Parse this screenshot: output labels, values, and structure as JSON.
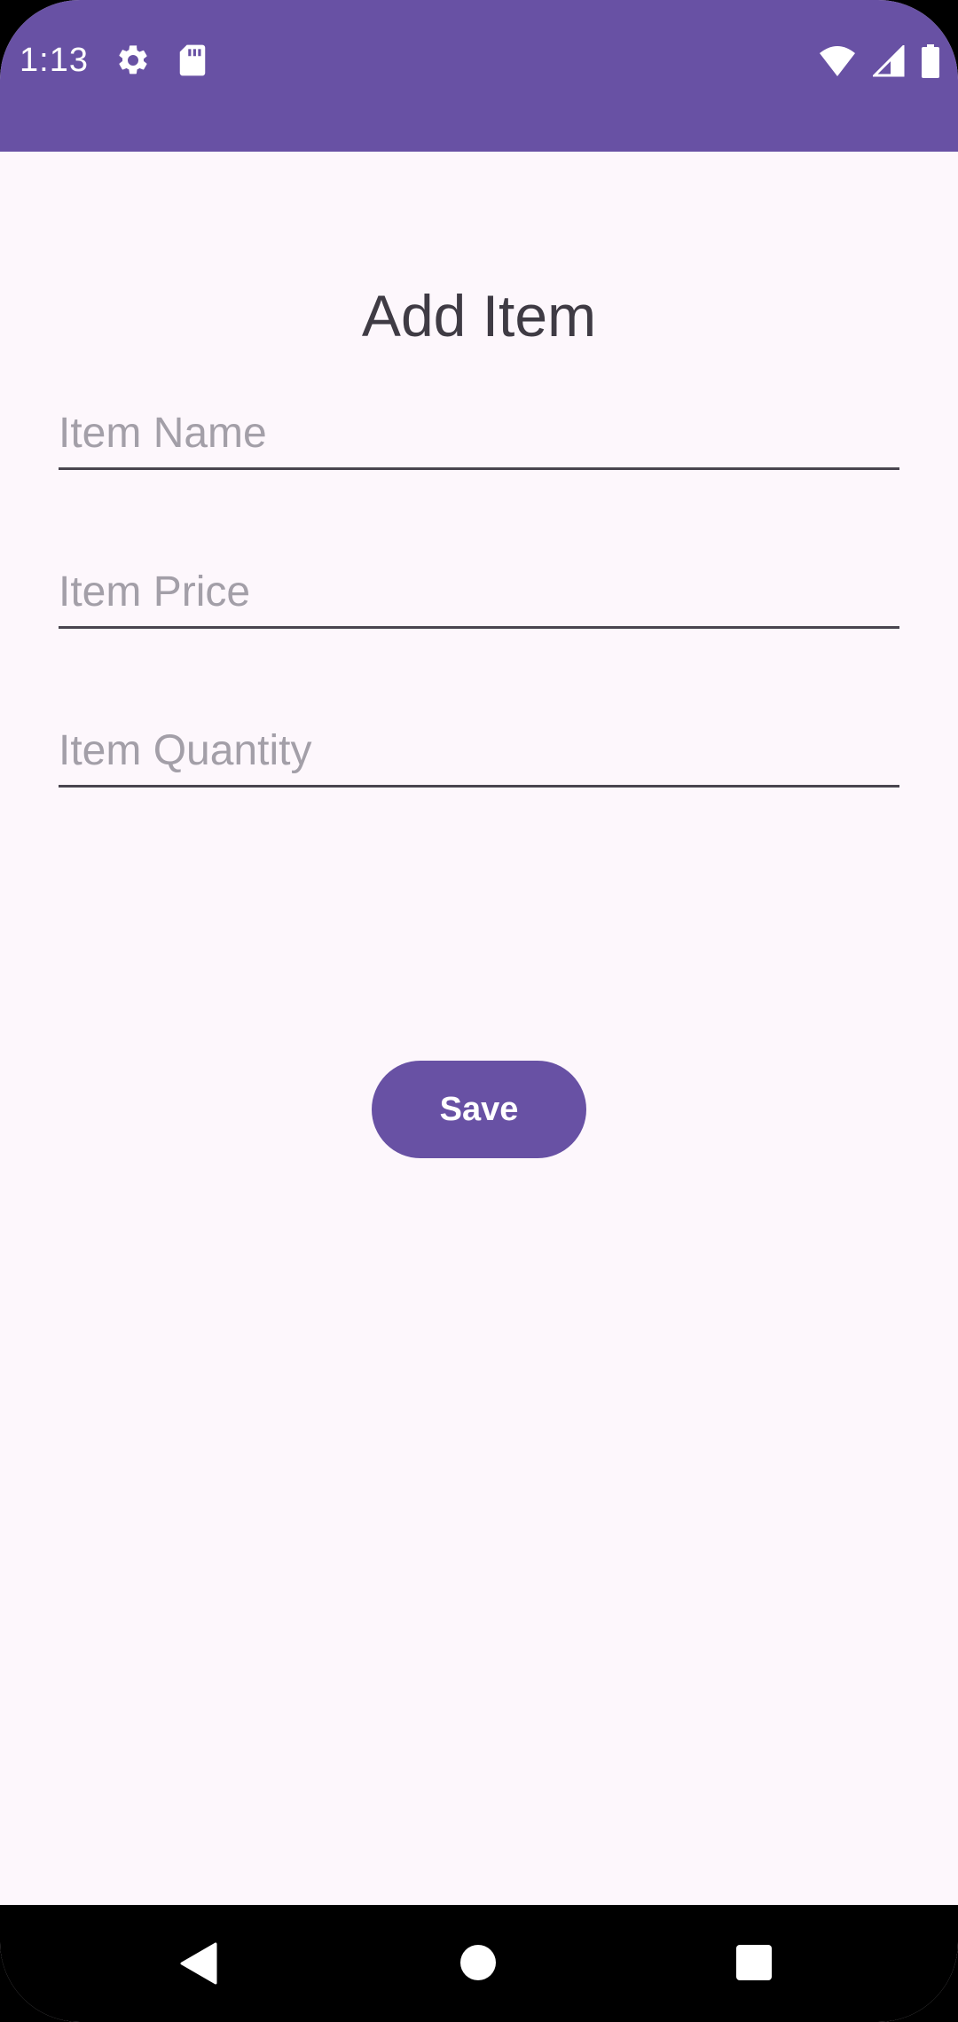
{
  "status_bar": {
    "time": "1:13",
    "background": "#6851A4",
    "left_icons": [
      "gear-icon",
      "sd-card-icon"
    ],
    "right_icons": [
      "wifi-icon",
      "cell-signal-icon",
      "battery-icon"
    ]
  },
  "page": {
    "title": "Add Item",
    "background": "#FDF7FC"
  },
  "form": {
    "fields": [
      {
        "placeholder": "Item Name",
        "value": ""
      },
      {
        "placeholder": "Item Price",
        "value": ""
      },
      {
        "placeholder": "Item Quantity",
        "value": ""
      }
    ],
    "save_label": "Save",
    "accent": "#6851A4"
  },
  "nav_bar": {
    "buttons": [
      "back-icon",
      "home-icon",
      "recents-icon"
    ]
  }
}
